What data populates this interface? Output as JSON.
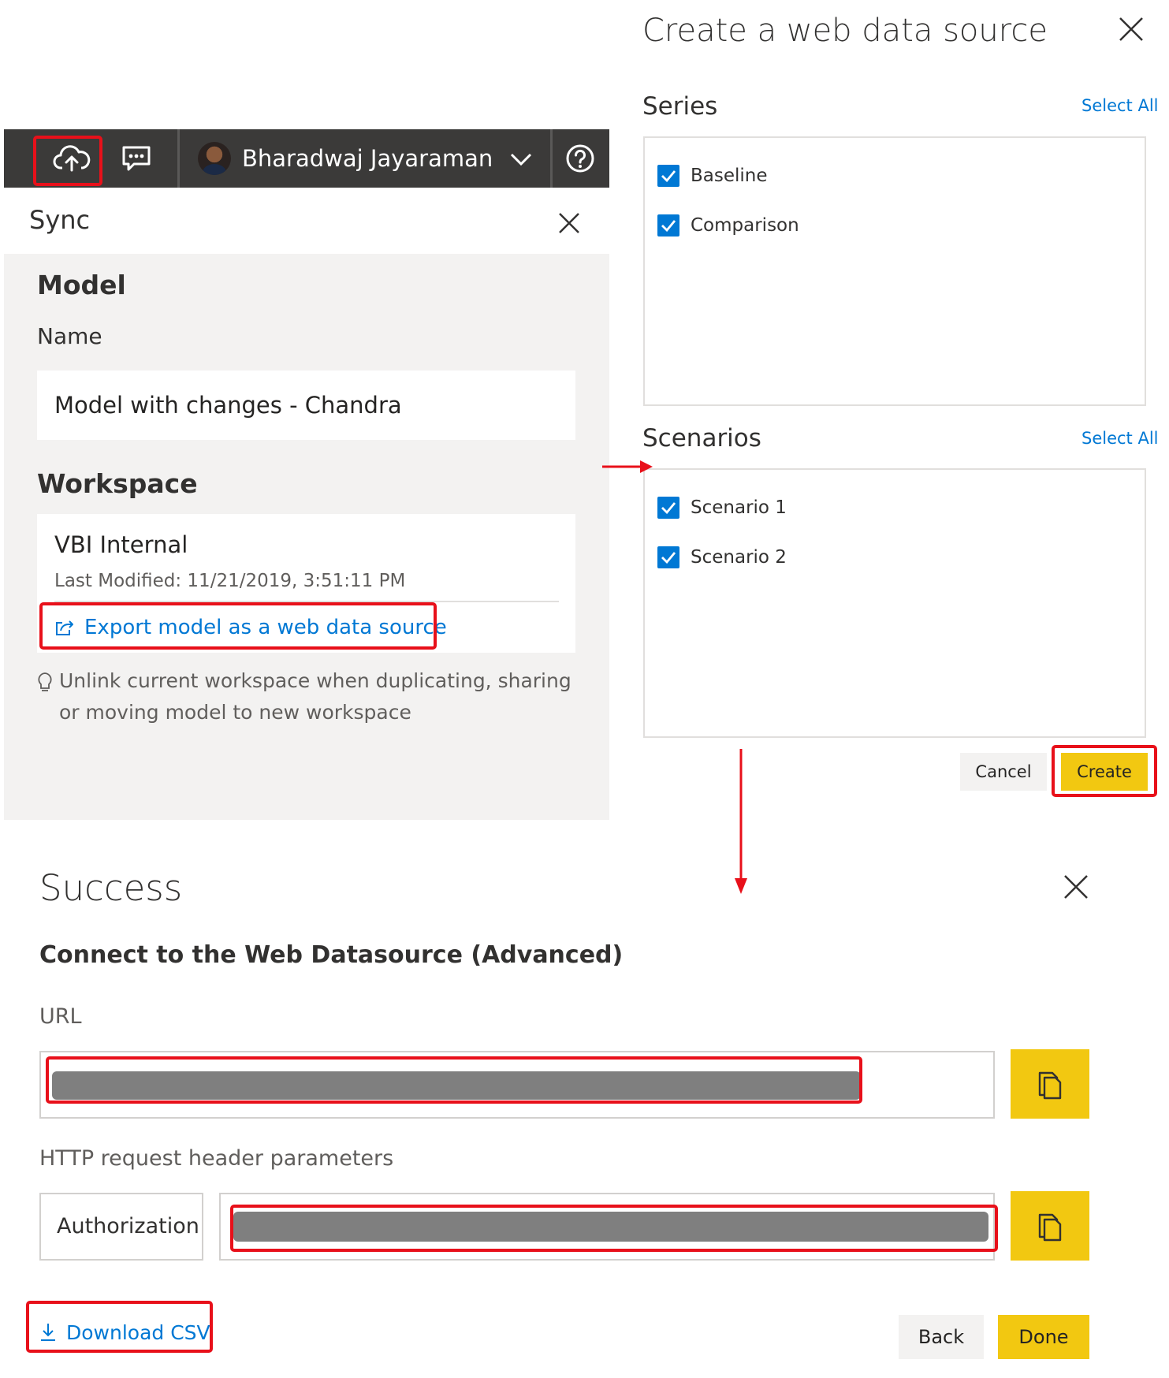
{
  "topbar": {
    "user_name": "Bharadwaj Jayaraman",
    "icons": [
      "cloud-upload-icon",
      "feedback-icon",
      "chevron-down-icon",
      "help-icon"
    ]
  },
  "sync": {
    "title": "Sync",
    "model_heading": "Model",
    "name_label": "Name",
    "name_value": "Model with changes - Chandra",
    "workspace_heading": "Workspace",
    "workspace_name": "VBI Internal",
    "last_modified": "Last Modified: 11/21/2019, 3:51:11 PM",
    "export_link": "Export model as a web data source",
    "tip": "Unlink current workspace when duplicating, sharing or moving model to new workspace"
  },
  "create": {
    "title": "Create a web data source",
    "series_heading": "Series",
    "series_select_all": "Select All",
    "series": [
      "Baseline",
      "Comparison"
    ],
    "scenarios_heading": "Scenarios",
    "scenarios_select_all": "Select All",
    "scenarios": [
      "Scenario 1",
      "Scenario 2"
    ],
    "cancel": "Cancel",
    "create": "Create"
  },
  "success": {
    "title": "Success",
    "subtitle": "Connect to the Web Datasource (Advanced)",
    "url_label": "URL",
    "headers_label": "HTTP request header parameters",
    "header_key": "Authorization",
    "download_csv": "Download CSV",
    "back": "Back",
    "done": "Done"
  },
  "colors": {
    "accent_blue": "#0078d4",
    "brand_yellow": "#f2c811",
    "topbar_bg": "#3b3a39",
    "annotation_red": "#e8101a"
  }
}
